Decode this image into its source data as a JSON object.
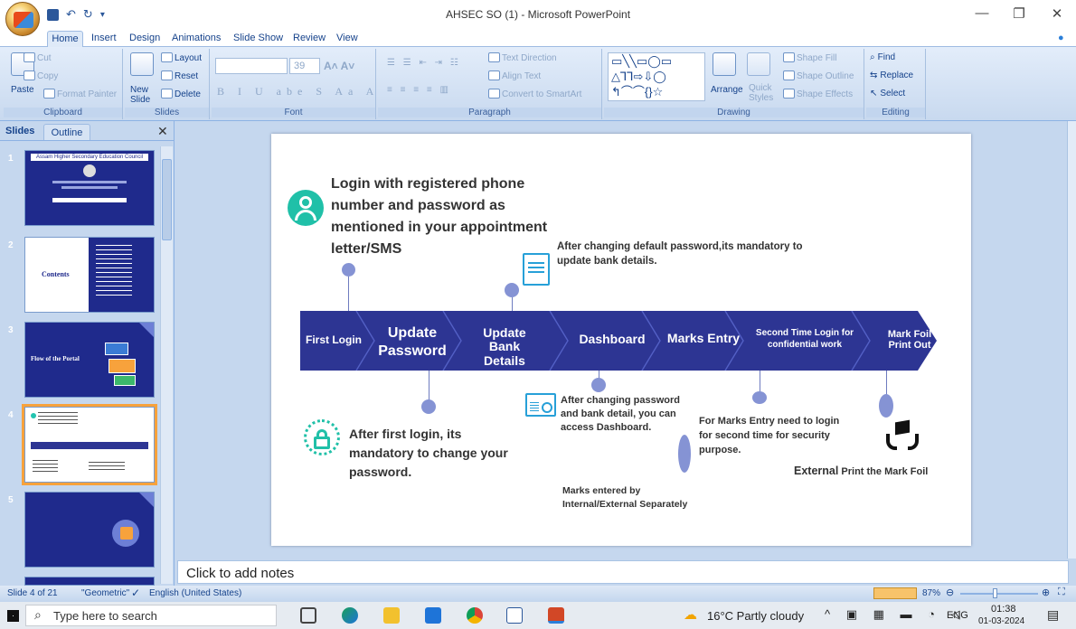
{
  "app": {
    "window_title": "AHSEC SO  (1) - Microsoft PowerPoint"
  },
  "window_controls": {
    "minimize": "—",
    "restore": "❐",
    "close": "✕"
  },
  "tabs": [
    "Home",
    "Insert",
    "Design",
    "Animations",
    "Slide Show",
    "Review",
    "View"
  ],
  "ribbon": {
    "clipboard": {
      "paste": "Paste",
      "cut": "Cut",
      "copy": "Copy",
      "format_painter": "Format Painter",
      "label": "Clipboard"
    },
    "slides": {
      "new_slide": "New Slide",
      "layout": "Layout",
      "reset": "Reset",
      "delete": "Delete",
      "label": "Slides"
    },
    "font": {
      "size": "39",
      "label": "Font"
    },
    "paragraph": {
      "text_direction": "Text Direction",
      "align_text": "Align Text",
      "convert": "Convert to SmartArt",
      "label": "Paragraph"
    },
    "drawing": {
      "arrange": "Arrange",
      "quick_styles": "Quick Styles",
      "shape_fill": "Shape Fill",
      "shape_outline": "Shape Outline",
      "shape_effects": "Shape Effects",
      "label": "Drawing"
    },
    "editing": {
      "find": "Find",
      "replace": "Replace",
      "select": "Select",
      "label": "Editing"
    }
  },
  "slides_pane": {
    "tab_slides": "Slides",
    "tab_outline": "Outline",
    "thumbs": [
      {
        "num": "1",
        "title": "Assam Higher Secondary Education Council"
      },
      {
        "num": "2",
        "title": "Contents"
      },
      {
        "num": "3",
        "title": "Flow of the Portal"
      },
      {
        "num": "4",
        "title": ""
      },
      {
        "num": "5",
        "title": ""
      }
    ]
  },
  "slide": {
    "login_text": "Login with registered phone number and password as mentioned in your appointment letter/SMS",
    "bank_text": "After changing default password,its mandatory to update bank details.",
    "steps": [
      {
        "label": "First Login"
      },
      {
        "label": "Update Password"
      },
      {
        "label": "Update Bank Details"
      },
      {
        "label": "Dashboard"
      },
      {
        "label": "Marks Entry"
      },
      {
        "label": "Second Time Login for confidential work"
      },
      {
        "label": "Mark Foil Print Out"
      }
    ],
    "change_pwd_text": "After first login, its mandatory to change your password.",
    "dashboard_text": "After changing password and bank detail, you can access Dashboard.",
    "marks_text": "Marks entered by Internal/External Separately",
    "second_login_text": "For Marks Entry need to login for second time for security purpose.",
    "external_bold": "External",
    "external_rest": " Print the Mark Foil"
  },
  "notes_placeholder": "Click to add notes",
  "status": {
    "slide_info": "Slide 4 of 21",
    "theme": "\"Geometric\"",
    "language": "English (United States)",
    "zoom": "87%"
  },
  "taskbar": {
    "search_placeholder": "Type here to search",
    "weather": "16°C  Partly cloudy",
    "lang": "ENG",
    "time": "01:38",
    "date": "01-03-2024"
  }
}
